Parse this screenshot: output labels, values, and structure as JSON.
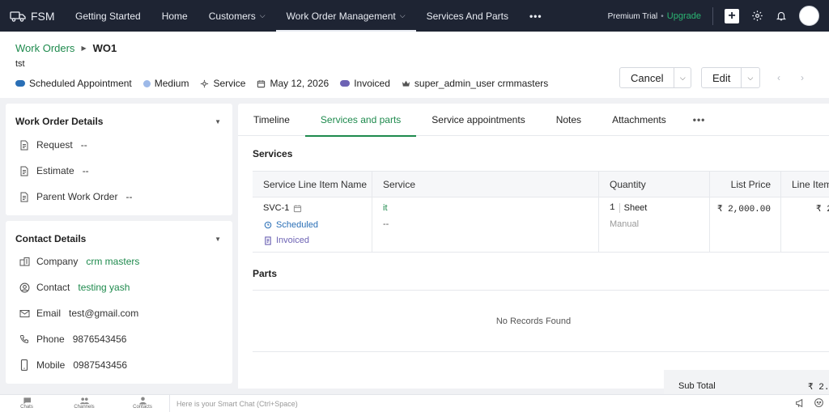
{
  "app": {
    "brand": "FSM"
  },
  "nav": {
    "items": [
      {
        "label": "Getting Started",
        "dropdown": false
      },
      {
        "label": "Home",
        "dropdown": false
      },
      {
        "label": "Customers",
        "dropdown": true
      },
      {
        "label": "Work Order Management",
        "dropdown": true,
        "active": true
      },
      {
        "label": "Services And Parts",
        "dropdown": false
      }
    ],
    "more": "•••",
    "trial_label": "Premium Trial",
    "trial_sep": "•",
    "upgrade_label": "Upgrade",
    "plus_label": "+"
  },
  "header": {
    "breadcrumb_parent": "Work Orders",
    "breadcrumb_current": "WO1",
    "subtitle": "tst",
    "chips": {
      "status": "Scheduled Appointment",
      "priority": "Medium",
      "type": "Service",
      "date": "May 12, 2026",
      "billing": "Invoiced",
      "owner": "super_admin_user crmmasters"
    },
    "cancel_label": "Cancel",
    "edit_label": "Edit",
    "prev_label": "‹",
    "next_label": "›"
  },
  "work_order_details": {
    "title": "Work Order Details",
    "fields": [
      {
        "label": "Request",
        "value": "--"
      },
      {
        "label": "Estimate",
        "value": "--"
      },
      {
        "label": "Parent Work Order",
        "value": "--"
      }
    ]
  },
  "contact_details": {
    "title": "Contact Details",
    "company_label": "Company",
    "company_value": "crm masters",
    "contact_label": "Contact",
    "contact_value": "testing yash",
    "email_label": "Email",
    "email_value": "test@gmail.com",
    "phone_label": "Phone",
    "phone_value": "9876543456",
    "mobile_label": "Mobile",
    "mobile_value": "0987543456"
  },
  "tabs": {
    "items": [
      "Timeline",
      "Services and parts",
      "Service appointments",
      "Notes",
      "Attachments"
    ],
    "more": "•••"
  },
  "services": {
    "title": "Services",
    "columns": [
      "Service Line Item Name",
      "Service",
      "Quantity",
      "List Price",
      "Line Item"
    ],
    "row": {
      "name": "SVC-1",
      "status_scheduled": "Scheduled",
      "status_invoiced": "Invoiced",
      "service": "it",
      "service_sub": "--",
      "qty": "1",
      "unit": "Sheet",
      "qty_sub": "Manual",
      "list_price": "₹ 2,000.00",
      "line_item": "₹ 2"
    }
  },
  "parts": {
    "title": "Parts",
    "empty": "No Records Found"
  },
  "subtotal": {
    "label": "Sub Total",
    "value": "₹ 2."
  },
  "bottom": {
    "chats": "Chats",
    "channels": "Channels",
    "contacts": "Contacts",
    "smart_chat_placeholder": "Here is your Smart Chat (Ctrl+Space)"
  },
  "colors": {
    "topbar": "#1e2433",
    "accent_green": "#1e8a4d",
    "status_blue": "#2a6fb6",
    "priority_blue": "#9db9e8",
    "invoiced_purple": "#6d63b4"
  }
}
